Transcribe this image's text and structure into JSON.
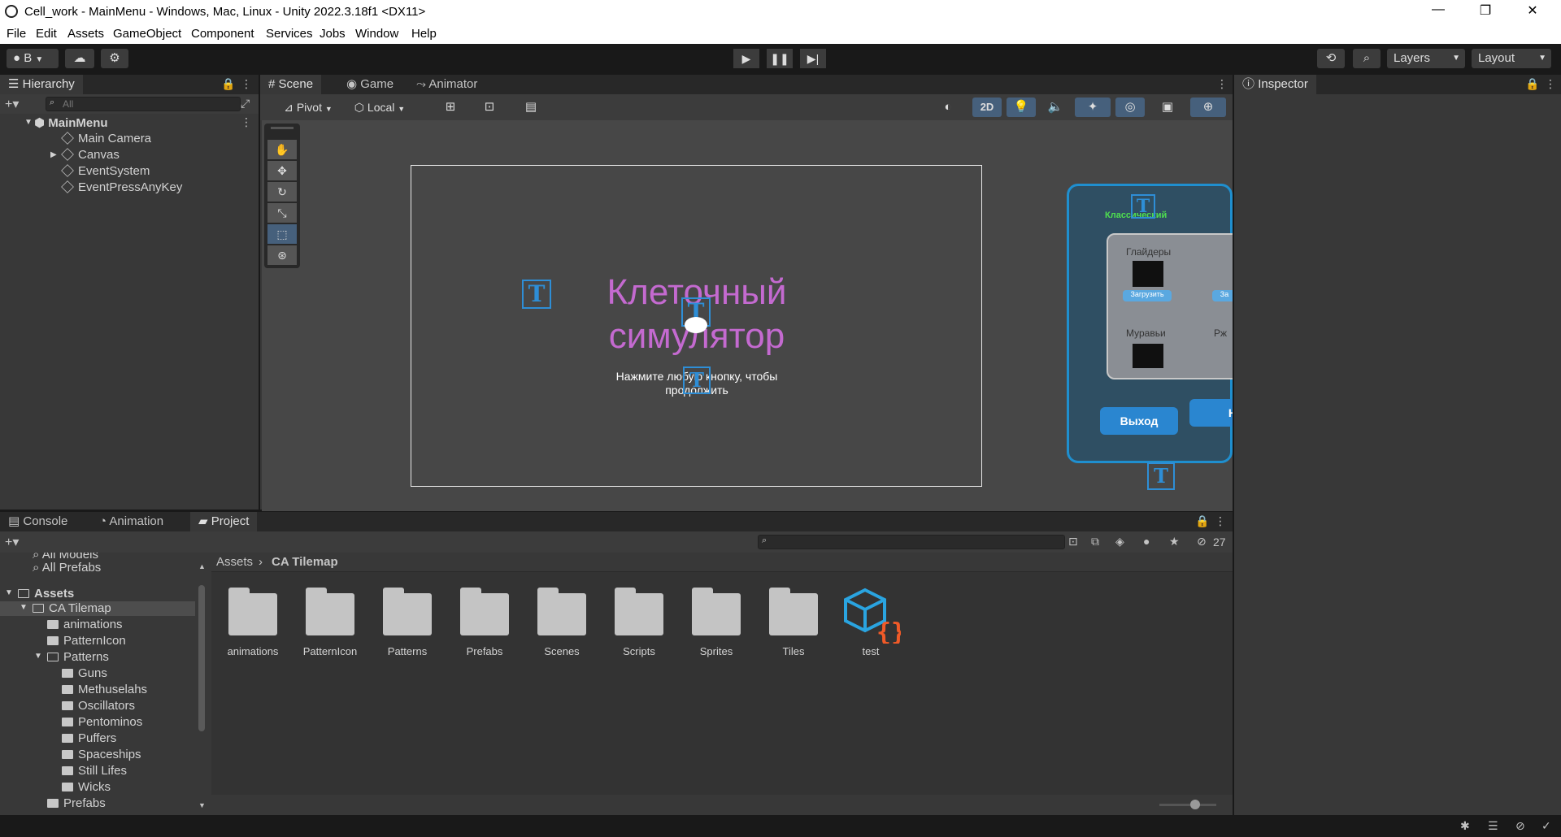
{
  "window": {
    "title": "Cell_work - MainMenu - Windows, Mac, Linux - Unity 2022.3.18f1 <DX11>",
    "minimize": "—",
    "maximize": "❐",
    "close": "✕"
  },
  "menu": [
    "File",
    "Edit",
    "Assets",
    "GameObject",
    "Component",
    "Services",
    "Jobs",
    "Window",
    "Help"
  ],
  "toolbar": {
    "account_label": "B",
    "layers_label": "Layers",
    "layout_label": "Layout"
  },
  "hierarchy": {
    "tab_label": "Hierarchy",
    "search_placeholder": "All",
    "scene_name": "MainMenu",
    "items": [
      "Main Camera",
      "Canvas",
      "EventSystem",
      "EventPressAnyKey"
    ]
  },
  "scene_tabs": [
    "Scene",
    "Game",
    "Animator"
  ],
  "scene_toolbar": {
    "pivot_label": "Pivot",
    "local_label": "Local",
    "mode_2d": "2D"
  },
  "scene": {
    "title_line1": "Клеточный",
    "title_line2": "симулятор",
    "subtitle_line1": "Нажмите любую кнопку, чтобы",
    "subtitle_line2": "продолжить",
    "side_menu": {
      "classic": "Классический",
      "gliders": "Глайдеры",
      "load": "Загрузить",
      "load2": "За",
      "muravi": "Муравьи",
      "rzh": "Рж",
      "exit": "Выход",
      "partial": "Н"
    },
    "title_color": "#c46ad0",
    "accent_color": "#2e8ed6"
  },
  "inspector": {
    "tab_label": "Inspector"
  },
  "bottom_tabs": [
    "Console",
    "Animation",
    "Project"
  ],
  "project": {
    "hidden_count": "27",
    "breadcrumb": [
      "Assets",
      "CA Tilemap"
    ],
    "favorites": [
      "All Models",
      "All Prefabs"
    ],
    "tree": {
      "root": "Assets",
      "ca_tilemap": "CA Tilemap",
      "animations": "animations",
      "pattern_icon": "PatternIcon",
      "patterns": "Patterns",
      "pattern_children": [
        "Guns",
        "Methuselahs",
        "Oscillators",
        "Pentominos",
        "Puffers",
        "Spaceships",
        "Still Lifes",
        "Wicks"
      ],
      "prefabs": "Prefabs"
    },
    "assets": [
      "animations",
      "PatternIcon",
      "Patterns",
      "Prefabs",
      "Scenes",
      "Scripts",
      "Sprites",
      "Tiles",
      "test"
    ]
  }
}
